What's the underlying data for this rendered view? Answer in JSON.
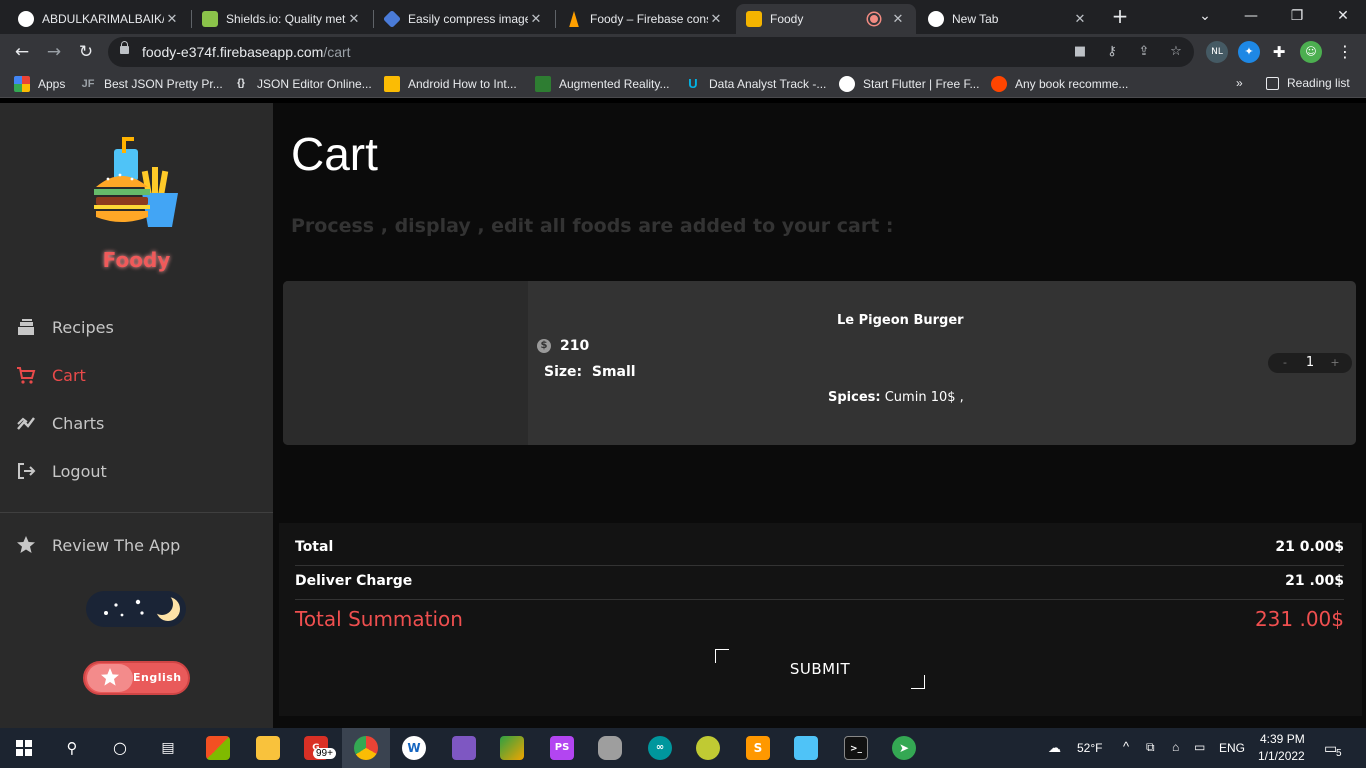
{
  "browser": {
    "tabs": [
      {
        "title": "ABDULKARIMALBAIK/",
        "icon_color": "#ffffff"
      },
      {
        "title": "Shields.io: Quality met",
        "icon_color": "#8bc34a"
      },
      {
        "title": "Easily compress image",
        "icon_color": "#4a7bd8"
      },
      {
        "title": "Foody – Firebase cons",
        "icon_color": "#ffa000"
      },
      {
        "title": "Foody",
        "icon_color": "#f4b400"
      },
      {
        "title": "New Tab",
        "icon_color": "#ffffff"
      }
    ],
    "url_host": "foody-e374f.firebaseapp.com",
    "url_path": "/cart",
    "bookmarks": [
      {
        "label": "Apps",
        "icon": "apps-grid-icon"
      },
      {
        "label": "Best JSON Pretty Pr...",
        "icon": "jf-icon"
      },
      {
        "label": "JSON Editor Online...",
        "icon": "braces-icon"
      },
      {
        "label": "Android How to Int...",
        "icon": "android-icon"
      },
      {
        "label": "Augmented Reality...",
        "icon": "ar-icon"
      },
      {
        "label": "Data Analyst Track -...",
        "icon": "udacity-icon"
      },
      {
        "label": "Start Flutter | Free F...",
        "icon": "flutter-icon"
      },
      {
        "label": "Any book recomme...",
        "icon": "reddit-icon"
      }
    ],
    "reading_list": "Reading list",
    "ext_badge": "NL",
    "more": "»"
  },
  "sidebar": {
    "brand": "Foody",
    "items": [
      {
        "label": "Recipes",
        "icon": "recipes-icon"
      },
      {
        "label": "Cart",
        "icon": "cart-icon"
      },
      {
        "label": "Charts",
        "icon": "chart-icon"
      },
      {
        "label": "Logout",
        "icon": "logout-icon"
      }
    ],
    "review": "Review The App",
    "language": "English"
  },
  "main": {
    "title": "Cart",
    "subtitle": "Process , display , edit all foods are added to your cart :",
    "cart_item": {
      "name": "Le Pigeon Burger",
      "price": "210",
      "size_label": "Size:",
      "size_value": "Small",
      "spices_label": "Spices:",
      "spices_value": "Cumin 10$ ,",
      "qty_minus": "-",
      "qty": "1",
      "qty_plus": "+"
    },
    "summary": {
      "total_label": "Total",
      "total_value": "21 0.00$",
      "delivery_label": "Deliver Charge",
      "delivery_value": "21 .00$",
      "sum_label": "Total Summation",
      "sum_value": "231 .00$",
      "submit": "SUBMIT"
    }
  },
  "taskbar": {
    "weather": "52°F",
    "lang": "ENG",
    "time": "4:39 PM",
    "date": "1/1/2022",
    "notif_count": "5",
    "gmail_badge": "99+"
  },
  "colors": {
    "accent": "#e84a4a",
    "sidebar": "#2a2a2a",
    "card": "#333333"
  }
}
